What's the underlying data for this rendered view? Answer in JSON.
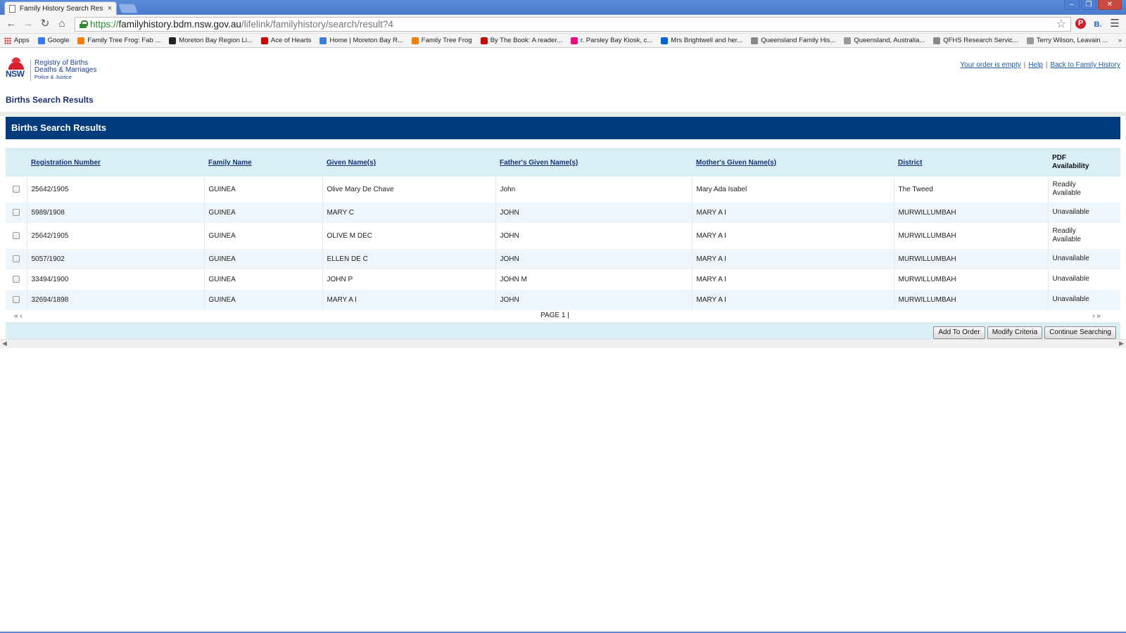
{
  "browser": {
    "tab_title": "Family History Search Results",
    "tab_close": "×",
    "window_buttons": [
      "–",
      "❐",
      "✕"
    ],
    "url": {
      "scheme": "https://",
      "host": "familyhistory.bdm.nsw.gov.au",
      "path": "/lifelink/familyhistory/search/result?4"
    },
    "bookmarks": [
      {
        "label": "Apps",
        "icon": "apps-icon",
        "color": "#d33333"
      },
      {
        "label": "Google",
        "icon": "google-icon",
        "color": "#3b78e7"
      },
      {
        "label": "Family Tree Frog: Fab ...",
        "icon": "blogger-icon",
        "color": "#f57d00"
      },
      {
        "label": "Moreton Bay Region Li...",
        "icon": "library-icon",
        "color": "#222222"
      },
      {
        "label": "Ace of Hearts",
        "icon": "bookmark-flag-icon",
        "color": "#cc0000"
      },
      {
        "label": "Home | Moreton Bay R...",
        "icon": "rainbow-icon",
        "color": "#3a7bd5"
      },
      {
        "label": "Family Tree Frog",
        "icon": "blogger-icon",
        "color": "#f57d00"
      },
      {
        "label": "By The Book: A reader...",
        "icon": "bookmark-flag-icon",
        "color": "#cc0000"
      },
      {
        "label": "r. Parsley Bay Kiosk, c...",
        "icon": "flickr-icon",
        "color": "#ff0084"
      },
      {
        "label": "Mrs Brightwell and her...",
        "icon": "flickr-icon",
        "color": "#0063dc"
      },
      {
        "label": "Queensland Family His...",
        "icon": "qfhs-icon",
        "color": "#888888"
      },
      {
        "label": "Queensland, Australia...",
        "icon": "page-icon",
        "color": "#999999"
      },
      {
        "label": "QFHS Research Servic...",
        "icon": "qfhs-icon",
        "color": "#888888"
      },
      {
        "label": "Terry Wilson, Leavain ...",
        "icon": "page-icon",
        "color": "#999999"
      }
    ],
    "bookmarks_more": "»"
  },
  "header": {
    "logo": {
      "mark": "NSW",
      "line1": "Registry of Births",
      "line2": "Deaths & Marriages",
      "line3": "Police & Justice"
    },
    "links": {
      "order": "Your order is empty",
      "help": "Help",
      "back": "Back to Family History",
      "separator": "|"
    },
    "page_title": "Births Search Results"
  },
  "results": {
    "title": "Births Search Results",
    "columns": {
      "registration": "Registration Number",
      "family": "Family Name",
      "given": "Given Name(s)",
      "father": "Father's Given Name(s)",
      "mother": "Mother's Given Name(s)",
      "district": "District",
      "pdf_line1": "PDF",
      "pdf_line2": "Availability"
    },
    "rows": [
      {
        "reg": "25642/1905",
        "family": "GUINEA",
        "given": "Olive Mary De Chave",
        "father": "John",
        "mother": "Mary Ada Isabel",
        "district": "The Tweed",
        "pdf1": "Readily",
        "pdf2": "Available"
      },
      {
        "reg": "5989/1908",
        "family": "GUINEA",
        "given": "MARY C",
        "father": "JOHN",
        "mother": "MARY A I",
        "district": "MURWILLUMBAH",
        "pdf1": "Unavailable",
        "pdf2": ""
      },
      {
        "reg": "25642/1905",
        "family": "GUINEA",
        "given": "OLIVE M DEC",
        "father": "JOHN",
        "mother": "MARY A I",
        "district": "MURWILLUMBAH",
        "pdf1": "Readily",
        "pdf2": "Available"
      },
      {
        "reg": "5057/1902",
        "family": "GUINEA",
        "given": "ELLEN DE C",
        "father": "JOHN",
        "mother": "MARY A I",
        "district": "MURWILLUMBAH",
        "pdf1": "Unavailable",
        "pdf2": ""
      },
      {
        "reg": "33494/1900",
        "family": "GUINEA",
        "given": "JOHN P",
        "father": "JOHN M",
        "mother": "MARY A I",
        "district": "MURWILLUMBAH",
        "pdf1": "Unavailable",
        "pdf2": ""
      },
      {
        "reg": "32694/1898",
        "family": "GUINEA",
        "given": "MARY A I",
        "father": "JOHN",
        "mother": "MARY A I",
        "district": "MURWILLUMBAH",
        "pdf1": "Unavailable",
        "pdf2": ""
      }
    ],
    "pager": {
      "first_prev": "« ‹",
      "label": "PAGE",
      "current": "1",
      "separator": "|",
      "next_last": "› »"
    },
    "buttons": {
      "add": "Add To Order",
      "modify": "Modify Criteria",
      "continue": "Continue Searching"
    }
  },
  "colors": {
    "header_band": "#003b7b",
    "table_header": "#daeef5",
    "link": "#1f5aa6",
    "row_alt": "#eef5fb"
  }
}
